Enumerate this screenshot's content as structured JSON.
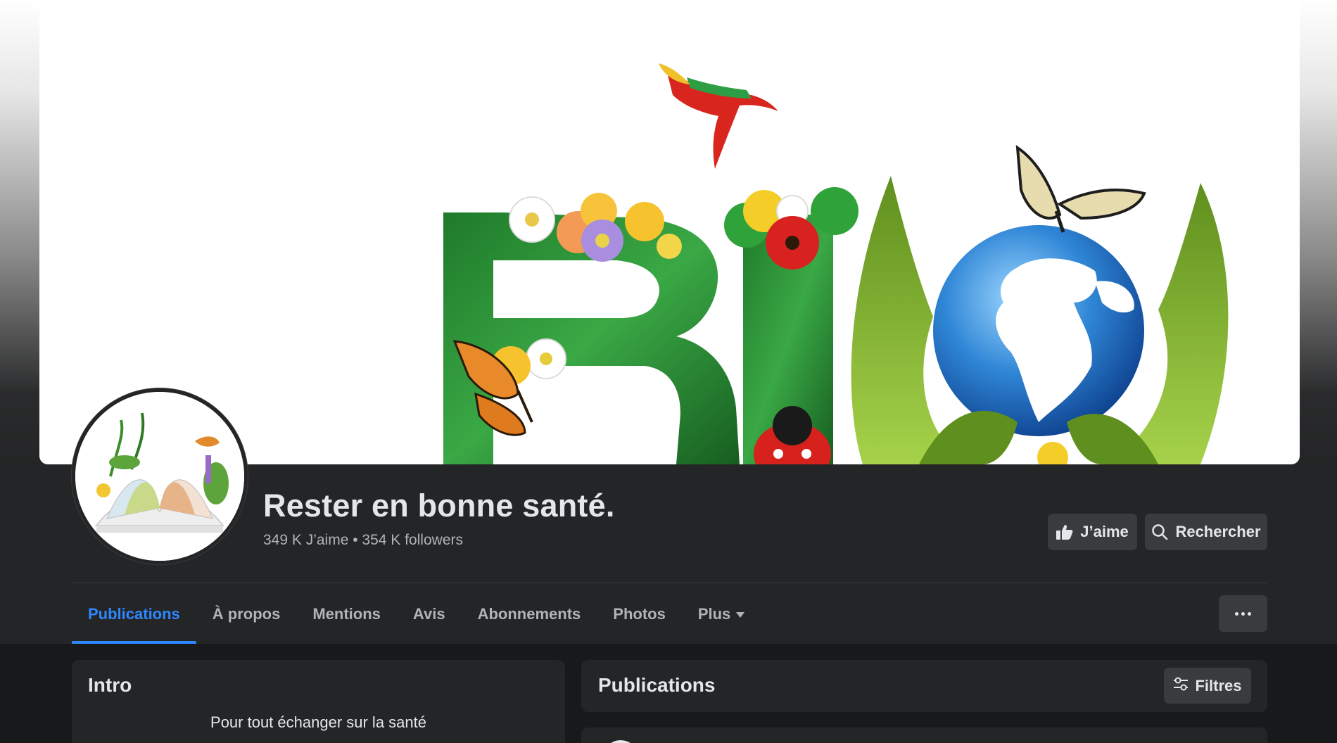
{
  "page": {
    "name": "Rester en bonne santé.",
    "stats": "349 K J’aime • 354 K followers"
  },
  "actions": {
    "like_label": "J’aime",
    "search_label": "Rechercher"
  },
  "tabs": [
    {
      "label": "Publications",
      "active": true
    },
    {
      "label": "À propos",
      "active": false
    },
    {
      "label": "Mentions",
      "active": false
    },
    {
      "label": "Avis",
      "active": false
    },
    {
      "label": "Abonnements",
      "active": false
    },
    {
      "label": "Photos",
      "active": false
    },
    {
      "label": "Plus",
      "active": false
    }
  ],
  "intro": {
    "title": "Intro",
    "text": "Pour tout échanger sur la santé"
  },
  "publications": {
    "title": "Publications",
    "filters_label": "Filtres"
  },
  "colors": {
    "accent": "#2d88ff",
    "background": "#18191a",
    "surface": "#242526",
    "button": "#3a3b3c"
  },
  "icons": {
    "like": "thumbs-up-icon",
    "search": "search-icon",
    "more": "ellipsis-icon",
    "filters": "sliders-icon",
    "dropdown": "caret-down-icon"
  }
}
